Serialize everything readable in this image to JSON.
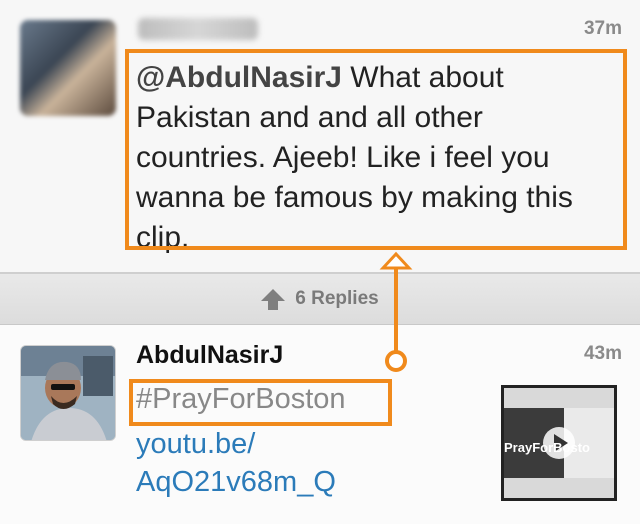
{
  "tweet_top": {
    "timestamp": "37m",
    "mention": "@AbdulNasirJ",
    "body": " What about Pakistan and and all other countries. Ajeeb! Like i feel you wanna be famous by making this clip."
  },
  "replies_bar": {
    "label": "6 Replies",
    "icon": "up-arrow-icon"
  },
  "tweet_bottom": {
    "author": "AbdulNasirJ",
    "timestamp": "43m",
    "hashtag": "#PrayForBoston",
    "link": "youtu.be/\nAqO21v68m_Q",
    "thumbnail_caption": "PrayForBosto"
  },
  "colors": {
    "highlight": "#f08a1c",
    "link": "#2b7bb9",
    "timestamp": "#8a8a8a"
  }
}
